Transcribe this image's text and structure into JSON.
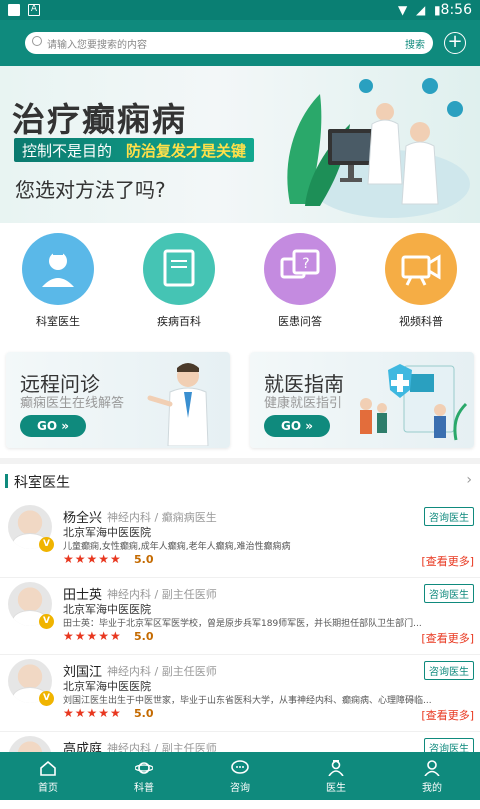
{
  "status": {
    "time": "8:56"
  },
  "search": {
    "placeholder": "请输入您要搜索的内容",
    "button": "搜索"
  },
  "banner": {
    "title": "治疗癫痫病",
    "tag_left": "控制不是目的",
    "tag_right": "防治复发才是关键",
    "question": "您选对方法了吗?"
  },
  "categories": [
    {
      "label": "科室医生",
      "color": "#5ab8e8",
      "icon": "doctor-icon"
    },
    {
      "label": "疾病百科",
      "color": "#45c4b4",
      "icon": "book-icon"
    },
    {
      "label": "医患问答",
      "color": "#c48be0",
      "icon": "qa-icon"
    },
    {
      "label": "视频科普",
      "color": "#f5ad45",
      "icon": "video-icon"
    }
  ],
  "promos": [
    {
      "title": "远程问诊",
      "subtitle": "癫痫医生在线解答",
      "button": "GO »"
    },
    {
      "title": "就医指南",
      "subtitle": "健康就医指引",
      "button": "GO »"
    }
  ],
  "section": {
    "title": "科室医生"
  },
  "doctors": [
    {
      "name": "杨全兴",
      "dept": "神经内科 / 癫痫病医生",
      "hospital": "北京军海中医医院",
      "desc": "儿童癫痫,女性癫痫,成年人癫痫,老年人癫痫,难治性癫痫病",
      "stars": "★★★★★",
      "score": "5.0",
      "consult": "咨询医生",
      "more": "[查看更多]"
    },
    {
      "name": "田士英",
      "dept": "神经内科 / 副主任医师",
      "hospital": "北京军海中医医院",
      "desc": "田士英：毕业于北京军区军医学校，曾是原步兵军189师军医，并长期担任部队卫生部门...",
      "stars": "★★★★★",
      "score": "5.0",
      "consult": "咨询医生",
      "more": "[查看更多]"
    },
    {
      "name": "刘国江",
      "dept": "神经内科 / 副主任医师",
      "hospital": "北京军海中医医院",
      "desc": "刘国江医生出生于中医世家，毕业于山东省医科大学，从事神经内科、癫痫病、心理障碍临...",
      "stars": "★★★★★",
      "score": "5.0",
      "consult": "咨询医生",
      "more": "[查看更多]"
    },
    {
      "name": "高成庭",
      "dept": "神经内科 / 副主任医师",
      "hospital": "",
      "desc": "",
      "stars": "",
      "score": "",
      "consult": "咨询医生",
      "more": ""
    }
  ],
  "tabs": [
    {
      "label": "首页",
      "icon": "home-icon"
    },
    {
      "label": "科普",
      "icon": "planet-icon"
    },
    {
      "label": "咨询",
      "icon": "chat-icon"
    },
    {
      "label": "医生",
      "icon": "doctor-icon"
    },
    {
      "label": "我的",
      "icon": "user-icon"
    }
  ]
}
